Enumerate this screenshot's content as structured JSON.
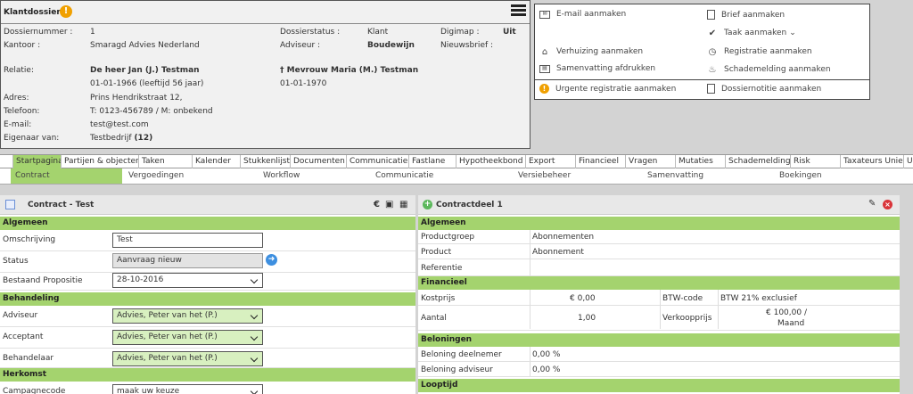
{
  "klant": {
    "title": "Klantdossier",
    "rows": {
      "dossiernummer_label": "Dossiernummer :",
      "dossiernummer": "1",
      "kantoor_label": "Kantoor :",
      "kantoor": "Smaragd Advies Nederland",
      "dossierstatus_label": "Dossierstatus :",
      "dossierstatus": "Klant",
      "adviseur_label": "Adviseur :",
      "adviseur": "Boudewijn",
      "digimap_label": "Digimap :",
      "digimap": "Uit",
      "nieuwsbrief_label": "Nieuwsbrief :",
      "relatie_label": "Relatie:",
      "relatie1_name": "De heer Jan (J.) Testman",
      "relatie1_birth": "01-01-1966 (leeftijd 56 jaar)",
      "relatie2_name": "† Mevrouw Maria (M.) Testman",
      "relatie2_birth": "01-01-1970",
      "adres_label": "Adres:",
      "adres": "Prins Hendrikstraat 12,",
      "telefoon_label": "Telefoon:",
      "telefoon": "T: 0123-456789 / M: onbekend",
      "email_label": "E-mail:",
      "email": "test@test.com",
      "eigenaar_label": "Eigenaar van:",
      "eigenaar": "Testbedrijf",
      "eigenaar_count": "(12)"
    }
  },
  "actions": {
    "email": "E-mail aanmaken",
    "brief": "Brief aanmaken",
    "taak": "Taak aanmaken",
    "verhuizing": "Verhuizing aanmaken",
    "registratie": "Registratie aanmaken",
    "samenvatting": "Samenvatting afdrukken",
    "schademelding": "Schademelding aanmaken",
    "urgent": "Urgente registratie aanmaken",
    "notitie": "Dossiernotitie aanmaken"
  },
  "nav": [
    "Startpagina",
    "Partijen & objecten",
    "Taken",
    "Kalender",
    "Stukkenlijst",
    "Documenten",
    "Communicatie",
    "Fastlane",
    "Hypotheekbond",
    "Export",
    "Financieel",
    "Vragen",
    "Mutaties",
    "Schademelding",
    "Risk",
    "Taxateurs Unie",
    "U"
  ],
  "subnav": [
    "Contract",
    "Vergoedingen",
    "Workflow",
    "Communicatie",
    "Versiebeheer",
    "Samenvatting",
    "Boekingen"
  ],
  "contract": {
    "title": "Contract - Test",
    "sec_algemeen": "Algemeen",
    "omschrijving_label": "Omschrijving",
    "omschrijving_value": "Test",
    "status_label": "Status",
    "status_value": "Aanvraag nieuw",
    "propositie_label": "Bestaand Propositie",
    "propositie_value": "28-10-2016",
    "sec_behandeling": "Behandeling",
    "adviseur_label": "Adviseur",
    "adviseur_value": "Advies, Peter van het (P.)",
    "acceptant_label": "Acceptant",
    "acceptant_value": "Advies, Peter van het (P.)",
    "behandelaar_label": "Behandelaar",
    "behandelaar_value": "Advies, Peter van het (P.)",
    "sec_herkomst": "Herkomst",
    "campagne_label": "Campagnecode",
    "campagne_value": "maak uw keuze"
  },
  "contractdeel": {
    "title": "Contractdeel 1",
    "sec_algemeen": "Algemeen",
    "productgroep_label": "Productgroep",
    "productgroep": "Abonnementen",
    "product_label": "Product",
    "product": "Abonnement",
    "referentie_label": "Referentie",
    "sec_financieel": "Financieel",
    "kostprijs_label": "Kostprijs",
    "kostprijs": "€ 0,00",
    "btwcode_label": "BTW-code",
    "btwcode": "BTW 21% exclusief",
    "aantal_label": "Aantal",
    "aantal": "1,00",
    "verkoopprijs_label": "Verkoopprijs",
    "verkoopprijs": "€ 100,00 /",
    "verkoopprijs_unit": "Maand",
    "sec_beloningen": "Beloningen",
    "bel_deelnemer_label": "Beloning deelnemer",
    "bel_deelnemer": "0,00 %",
    "bel_adviseur_label": "Beloning adviseur",
    "bel_adviseur": "0,00 %",
    "sec_looptijd": "Looptijd"
  },
  "colors": {
    "accent_green": "#a4d36e",
    "warning": "#f0a000"
  }
}
